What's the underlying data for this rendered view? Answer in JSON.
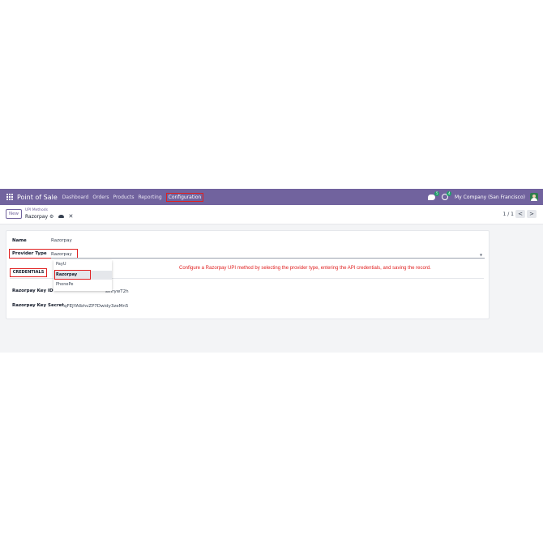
{
  "navbar": {
    "brand": "Point of Sale",
    "menu": [
      "Dashboard",
      "Orders",
      "Products",
      "Reporting",
      "Configuration"
    ],
    "active_menu": "Configuration",
    "messages_count": "5",
    "activities_count": "4",
    "company": "My Company (San Francisco)"
  },
  "control_panel": {
    "new_label": "New",
    "breadcrumb": "UPI Methods",
    "record_title": "Razorpay",
    "pager": "1 / 1",
    "prev": "<",
    "next": ">"
  },
  "form": {
    "name_label": "Name",
    "name_value": "Razorpay",
    "provider_type_label": "Provider Type",
    "provider_type_value": "Razorpay",
    "credentials_tab": "CREDENTIALS",
    "key_id_label": "Razorpay Key ID",
    "key_id_value": "rzp_live_...smrywT2h",
    "key_id_visible_tail": "smrywT2h",
    "key_secret_label": "Razorpay Key Secret",
    "key_secret_value": "qFEJYAIbhvZP7Dwidy3zeMn5"
  },
  "dropdown": {
    "options": [
      "PayU",
      "Razorpay",
      "PhonePe"
    ],
    "selected": "Razorpay"
  },
  "instruction": "Configure a Razorpay UPI method by selecting the provider type, entering the API credentials, and saving the record.",
  "colors": {
    "navbar": "#71639e",
    "highlight": "#e02020",
    "background": "#f3f4f6"
  }
}
